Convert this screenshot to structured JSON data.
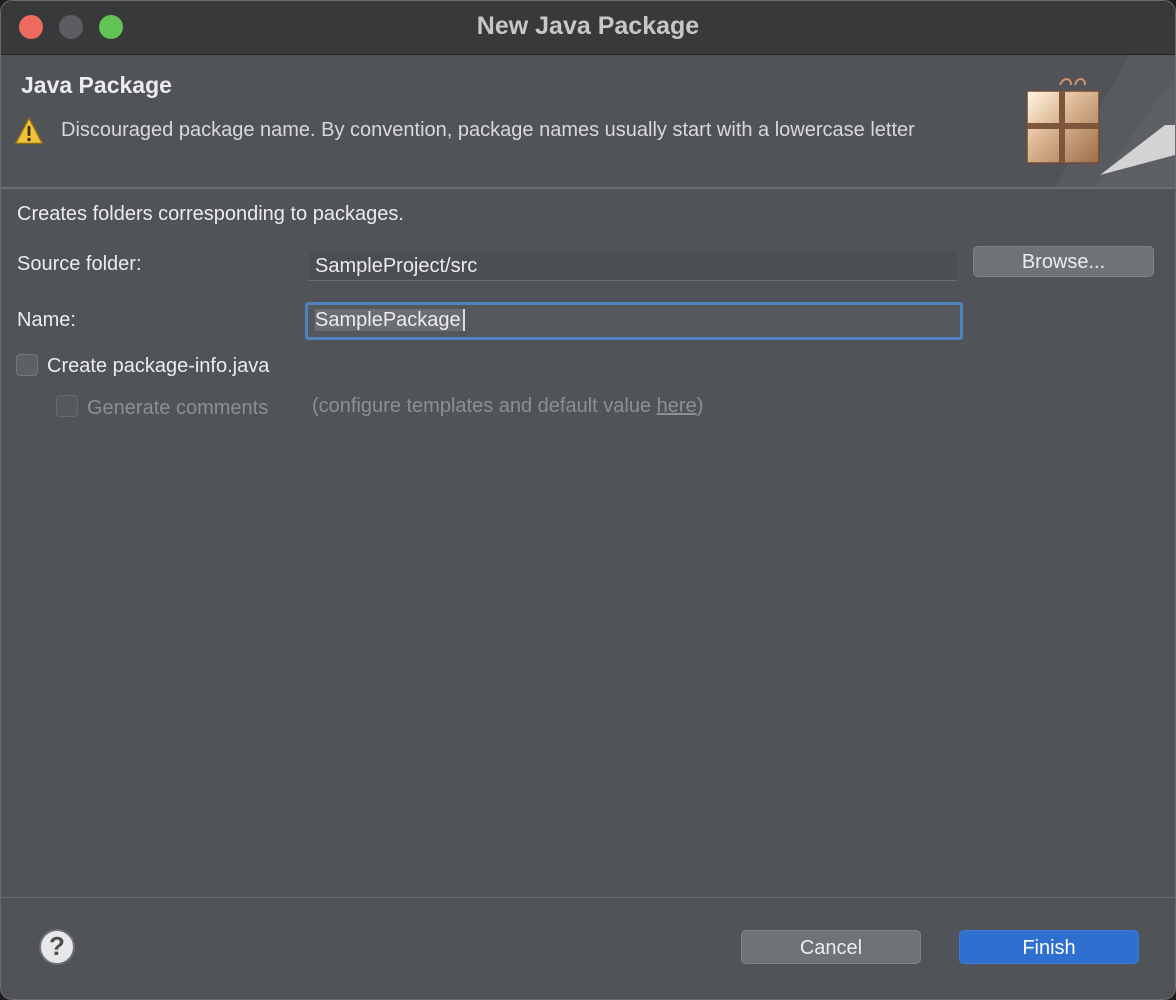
{
  "window": {
    "title": "New Java Package"
  },
  "header": {
    "title": "Java Package",
    "warning_icon": "warning-icon",
    "message": "Discouraged package name. By convention, package names usually start with a lowercase letter",
    "banner_icon": "package-wizard-banner-icon"
  },
  "content": {
    "description": "Creates folders corresponding to packages.",
    "source_folder": {
      "label": "Source folder:",
      "value": "SampleProject/src",
      "browse_label": "Browse..."
    },
    "name": {
      "label": "Name:",
      "value": "SamplePackage"
    },
    "create_package_info": {
      "label": "Create package-info.java",
      "checked": false
    },
    "generate_comments": {
      "label": "Generate comments",
      "checked": false,
      "enabled": false,
      "hint_prefix": "(configure templates and default value ",
      "hint_link": "here",
      "hint_suffix": ")"
    }
  },
  "footer": {
    "help_icon": "help-icon",
    "help_glyph": "?",
    "cancel_label": "Cancel",
    "finish_label": "Finish"
  },
  "colors": {
    "accent": "#2f6fd0",
    "focus_ring": "#4f83bf",
    "warning": "#f0c23a"
  }
}
